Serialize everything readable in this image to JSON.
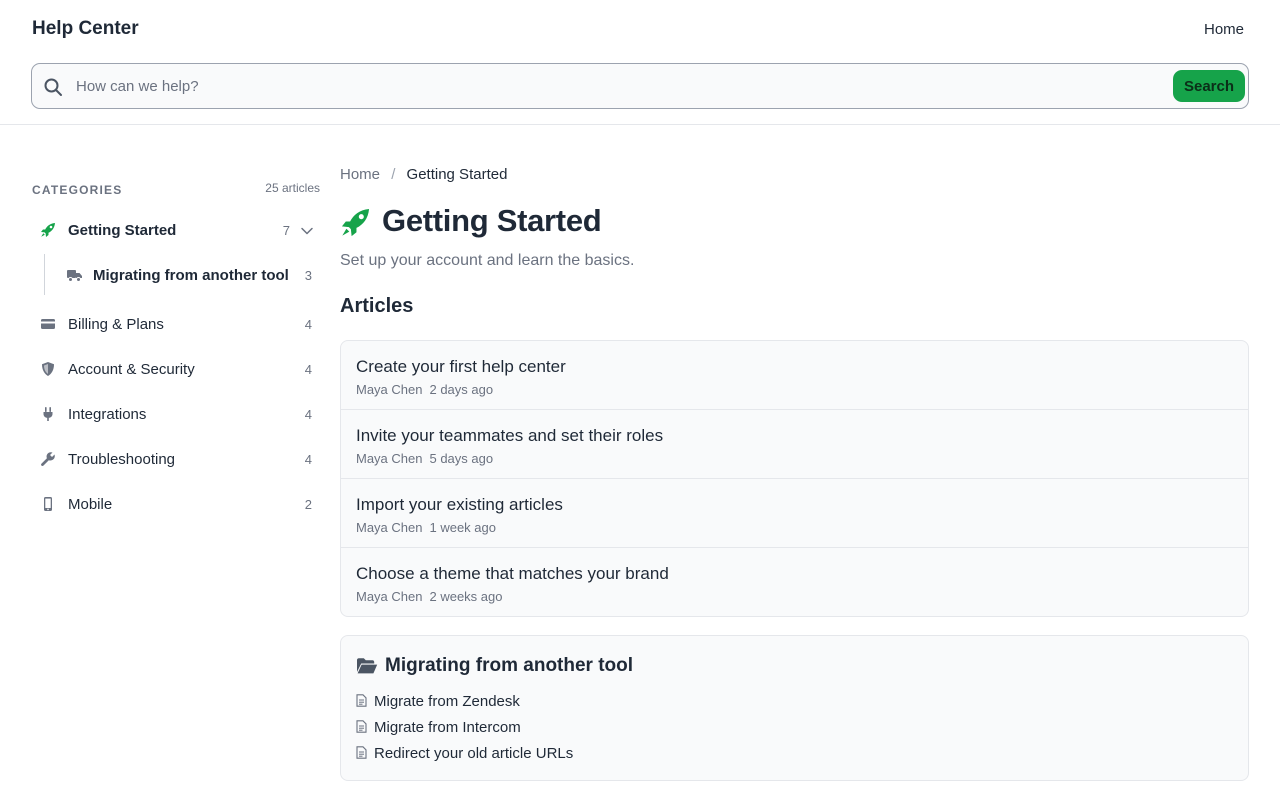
{
  "header": {
    "brand": "Help Center",
    "nav_home": "Home"
  },
  "search": {
    "placeholder": "How can we help?",
    "value": "",
    "button_label": "Search"
  },
  "sidebar": {
    "title": "CATEGORIES",
    "total": "25 articles",
    "items": [
      {
        "label": "Getting Started",
        "count": "7",
        "icon": "rocket-icon",
        "active": true
      },
      {
        "label": "Billing & Plans",
        "count": "4",
        "icon": "credit-card-icon"
      },
      {
        "label": "Account & Security",
        "count": "4",
        "icon": "shield-icon"
      },
      {
        "label": "Integrations",
        "count": "4",
        "icon": "plug-icon"
      },
      {
        "label": "Troubleshooting",
        "count": "4",
        "icon": "wrench-icon"
      },
      {
        "label": "Mobile",
        "count": "2",
        "icon": "mobile-icon"
      }
    ],
    "subitems": [
      {
        "label": "Migrating from another tool",
        "count": "3",
        "icon": "truck-icon"
      }
    ]
  },
  "main": {
    "breadcrumb": {
      "home": "Home",
      "separator": "/",
      "current": "Getting Started"
    },
    "title": "Getting Started",
    "subtitle": "Set up your account and learn the basics.",
    "articles_heading": "Articles",
    "articles": [
      {
        "title": "Create your first help center",
        "author": "Maya Chen",
        "time": "2 days ago"
      },
      {
        "title": "Invite your teammates and set their roles",
        "author": "Maya Chen",
        "time": "5 days ago"
      },
      {
        "title": "Import your existing articles",
        "author": "Maya Chen",
        "time": "1 week ago"
      },
      {
        "title": "Choose a theme that matches your brand",
        "author": "Maya Chen",
        "time": "2 weeks ago"
      }
    ],
    "subcategory": {
      "title": "Migrating from another tool",
      "icon": "folder-open-icon",
      "links": [
        {
          "label": "Migrate from Zendesk"
        },
        {
          "label": "Migrate from Intercom"
        },
        {
          "label": "Redirect your old article URLs"
        }
      ]
    }
  },
  "colors": {
    "accent": "#16a34a",
    "text": "#1f2937",
    "muted": "#6b7280",
    "border": "#e5e7eb",
    "card_bg": "#f9fafb"
  }
}
